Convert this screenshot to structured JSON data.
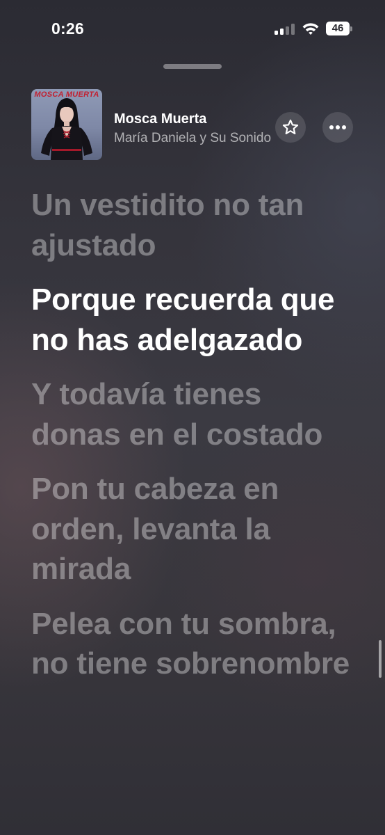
{
  "status_bar": {
    "time": "0:26",
    "battery": "46"
  },
  "now_playing": {
    "album_art_text": "MOSCA MUERTA",
    "title": "Mosca Muerta",
    "artist": "María Daniela y Su Sonido Lasser"
  },
  "lyrics": [
    {
      "text": "Un vestidito no tan ajustado",
      "active": false
    },
    {
      "text": "Porque recuerda que no has adelgazado",
      "active": true
    },
    {
      "text": "Y todavía tienes donas en el costado",
      "active": false
    },
    {
      "text": "Pon tu cabeza en orden, levanta la mirada",
      "active": false
    },
    {
      "text": "Pelea con tu sombra, no tiene sobrenombre",
      "active": false
    }
  ],
  "icons": {
    "favorite": "star-icon",
    "more": "ellipsis-icon",
    "signal": "cellular-signal-icon",
    "wifi": "wifi-icon",
    "battery": "battery-icon"
  }
}
